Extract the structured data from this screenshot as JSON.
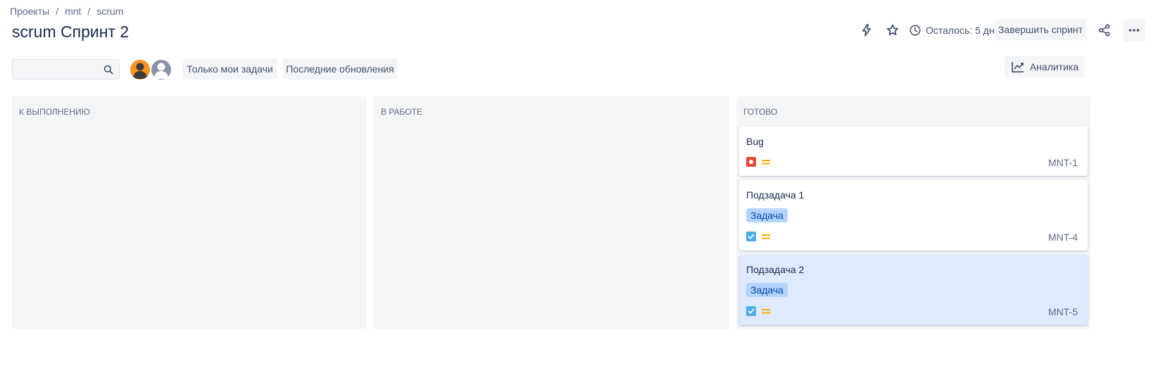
{
  "breadcrumb": [
    "Проекты",
    "mnt",
    "scrum"
  ],
  "breadcrumb_separator": "/",
  "page_title": "scrum Спринт 2",
  "header": {
    "remaining": "Осталось: 5 дн.",
    "complete_sprint": "Завершить спринт",
    "icons": [
      "lightning-icon",
      "star-icon",
      "clock-icon",
      "share-icon",
      "more-icon"
    ]
  },
  "filters": {
    "search_placeholder": "",
    "only_my_issues": "Только мои задачи",
    "recently_updated": "Последние обновления",
    "avatars": [
      "user-avatar",
      "default-avatar"
    ]
  },
  "analytics": "Аналитика",
  "colors": {
    "accent": "#0052cc",
    "bug_red": "#e5493a",
    "task_blue": "#4bade8",
    "priority_medium": "#ffab00",
    "selected_card": "#deebff",
    "tag_bg": "#b3d4ff"
  },
  "columns": [
    {
      "title": "К ВЫПОЛНЕНИЮ",
      "cards": []
    },
    {
      "title": "В РАБОТЕ",
      "cards": []
    },
    {
      "title": "ГОТОВО",
      "cards": [
        {
          "title": "Bug",
          "type": "bug",
          "priority": "medium",
          "key": "MNT-1",
          "tag": ""
        },
        {
          "title": "Подзадача 1",
          "type": "subtask",
          "priority": "medium",
          "key": "MNT-4",
          "tag": "Задача"
        },
        {
          "title": "Подзадача 2",
          "type": "subtask",
          "priority": "medium",
          "key": "MNT-5",
          "tag": "Задача",
          "selected": true
        }
      ]
    }
  ]
}
